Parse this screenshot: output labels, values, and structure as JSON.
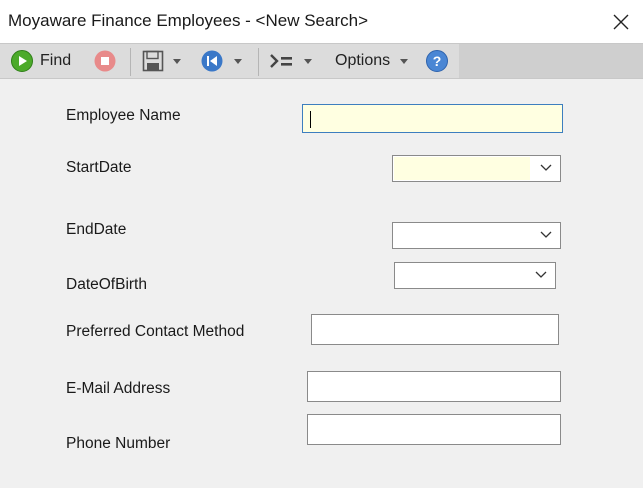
{
  "window": {
    "title": "Moyaware Finance Employees - <New Search>"
  },
  "toolbar": {
    "find_label": "Find",
    "options_label": "Options",
    "colors": {
      "find_icon": "#4caa2a",
      "stop_icon": "#e88a8a",
      "nav_icon": "#3a78c8",
      "help_icon": "#4a86d4"
    }
  },
  "form": {
    "fields": [
      {
        "label": "Employee Name",
        "value": "",
        "type": "text",
        "focused": true
      },
      {
        "label": "StartDate",
        "value": "",
        "type": "date"
      },
      {
        "label": "EndDate",
        "value": "",
        "type": "date"
      },
      {
        "label": "DateOfBirth",
        "value": "",
        "type": "date"
      },
      {
        "label": "Preferred Contact Method",
        "value": "",
        "type": "text"
      },
      {
        "label": "E-Mail Address",
        "value": "",
        "type": "text"
      },
      {
        "label": "Phone Number",
        "value": "",
        "type": "text"
      }
    ],
    "focus_color": "#ffffe1"
  }
}
